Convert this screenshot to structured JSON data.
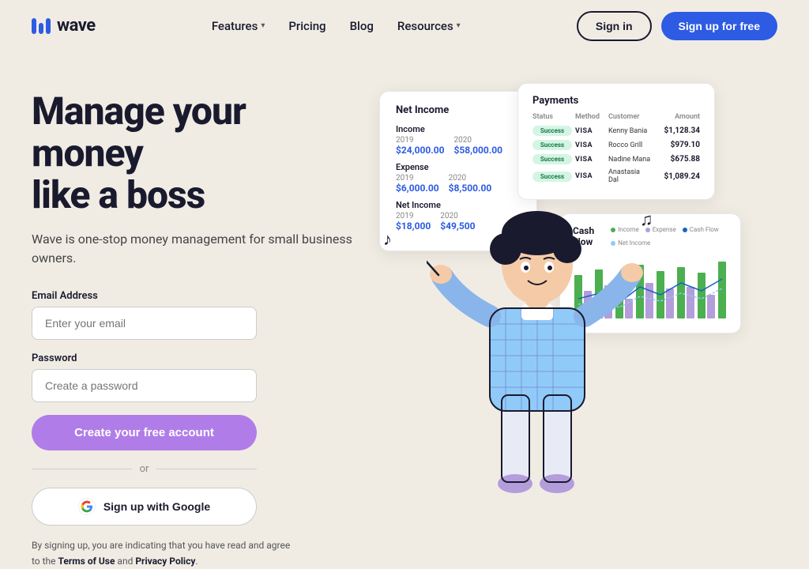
{
  "brand": {
    "name": "wave",
    "logo_alt": "Wave logo"
  },
  "nav": {
    "features_label": "Features",
    "pricing_label": "Pricing",
    "blog_label": "Blog",
    "resources_label": "Resources",
    "signin_label": "Sign in",
    "signup_label": "Sign up for free"
  },
  "hero": {
    "headline_line1": "Manage your money",
    "headline_line2": "like a boss",
    "subheadline": "Wave is one-stop money management for small business owners."
  },
  "form": {
    "email_label": "Email Address",
    "email_placeholder": "Enter your email",
    "password_label": "Password",
    "password_placeholder": "Create a password",
    "create_btn": "Create your free account",
    "or_divider": "or",
    "google_btn": "Sign up with Google",
    "terms_prefix": "By signing up, you are indicating that you have read and agree to the ",
    "terms_link": "Terms of Use",
    "terms_and": " and ",
    "privacy_link": "Privacy Policy",
    "terms_suffix": "."
  },
  "income_card": {
    "title": "Net Income",
    "income_label": "Income",
    "income_2019": "2019",
    "income_2019_val": "$24,000.00",
    "income_2020": "2020",
    "income_2020_val": "$58,000.00",
    "expense_label": "Expense",
    "expense_2019": "2019",
    "expense_2019_val": "$6,000.00",
    "expense_2020": "2020",
    "expense_2020_val": "$8,500.00",
    "net_label": "Net Income",
    "net_2019": "2019",
    "net_2019_val": "$18,000",
    "net_2020": "2020",
    "net_2020_val": "$49,500"
  },
  "payments_card": {
    "title": "Payments",
    "col_status": "Status",
    "col_method": "Method",
    "col_customer": "Customer",
    "col_amount": "Amount",
    "rows": [
      {
        "status": "Success",
        "method": "VISA",
        "customer": "Kenny Bania",
        "amount": "$1,128.34"
      },
      {
        "status": "Success",
        "method": "VISA",
        "customer": "Rocco Grill",
        "amount": "$979.10"
      },
      {
        "status": "Success",
        "method": "VISA",
        "customer": "Nadine Mana",
        "amount": "$675.88"
      },
      {
        "status": "Success",
        "method": "VISA",
        "customer": "Anastasia Dal",
        "amount": "$1,089.24"
      }
    ]
  },
  "cashflow_card": {
    "title": "Cash Flow",
    "legend": [
      {
        "label": "Income",
        "color": "#4caf50"
      },
      {
        "label": "Expense",
        "color": "#b39ddb"
      },
      {
        "label": "Cash Flow",
        "color": "#1565c0"
      },
      {
        "label": "Net Income",
        "color": "#90caf9"
      }
    ],
    "bars": [
      {
        "income": 55,
        "expense": 30
      },
      {
        "income": 65,
        "expense": 35
      },
      {
        "income": 40,
        "expense": 25
      },
      {
        "income": 70,
        "expense": 40
      },
      {
        "income": 50,
        "expense": 20
      },
      {
        "income": 60,
        "expense": 45
      },
      {
        "income": 75,
        "expense": 35
      },
      {
        "income": 45,
        "expense": 30
      }
    ]
  },
  "colors": {
    "bg": "#f0ece4",
    "primary_blue": "#2d5be3",
    "purple_btn": "#b07de8",
    "dark": "#1a1a2e",
    "success_green": "#d4f5e4"
  }
}
